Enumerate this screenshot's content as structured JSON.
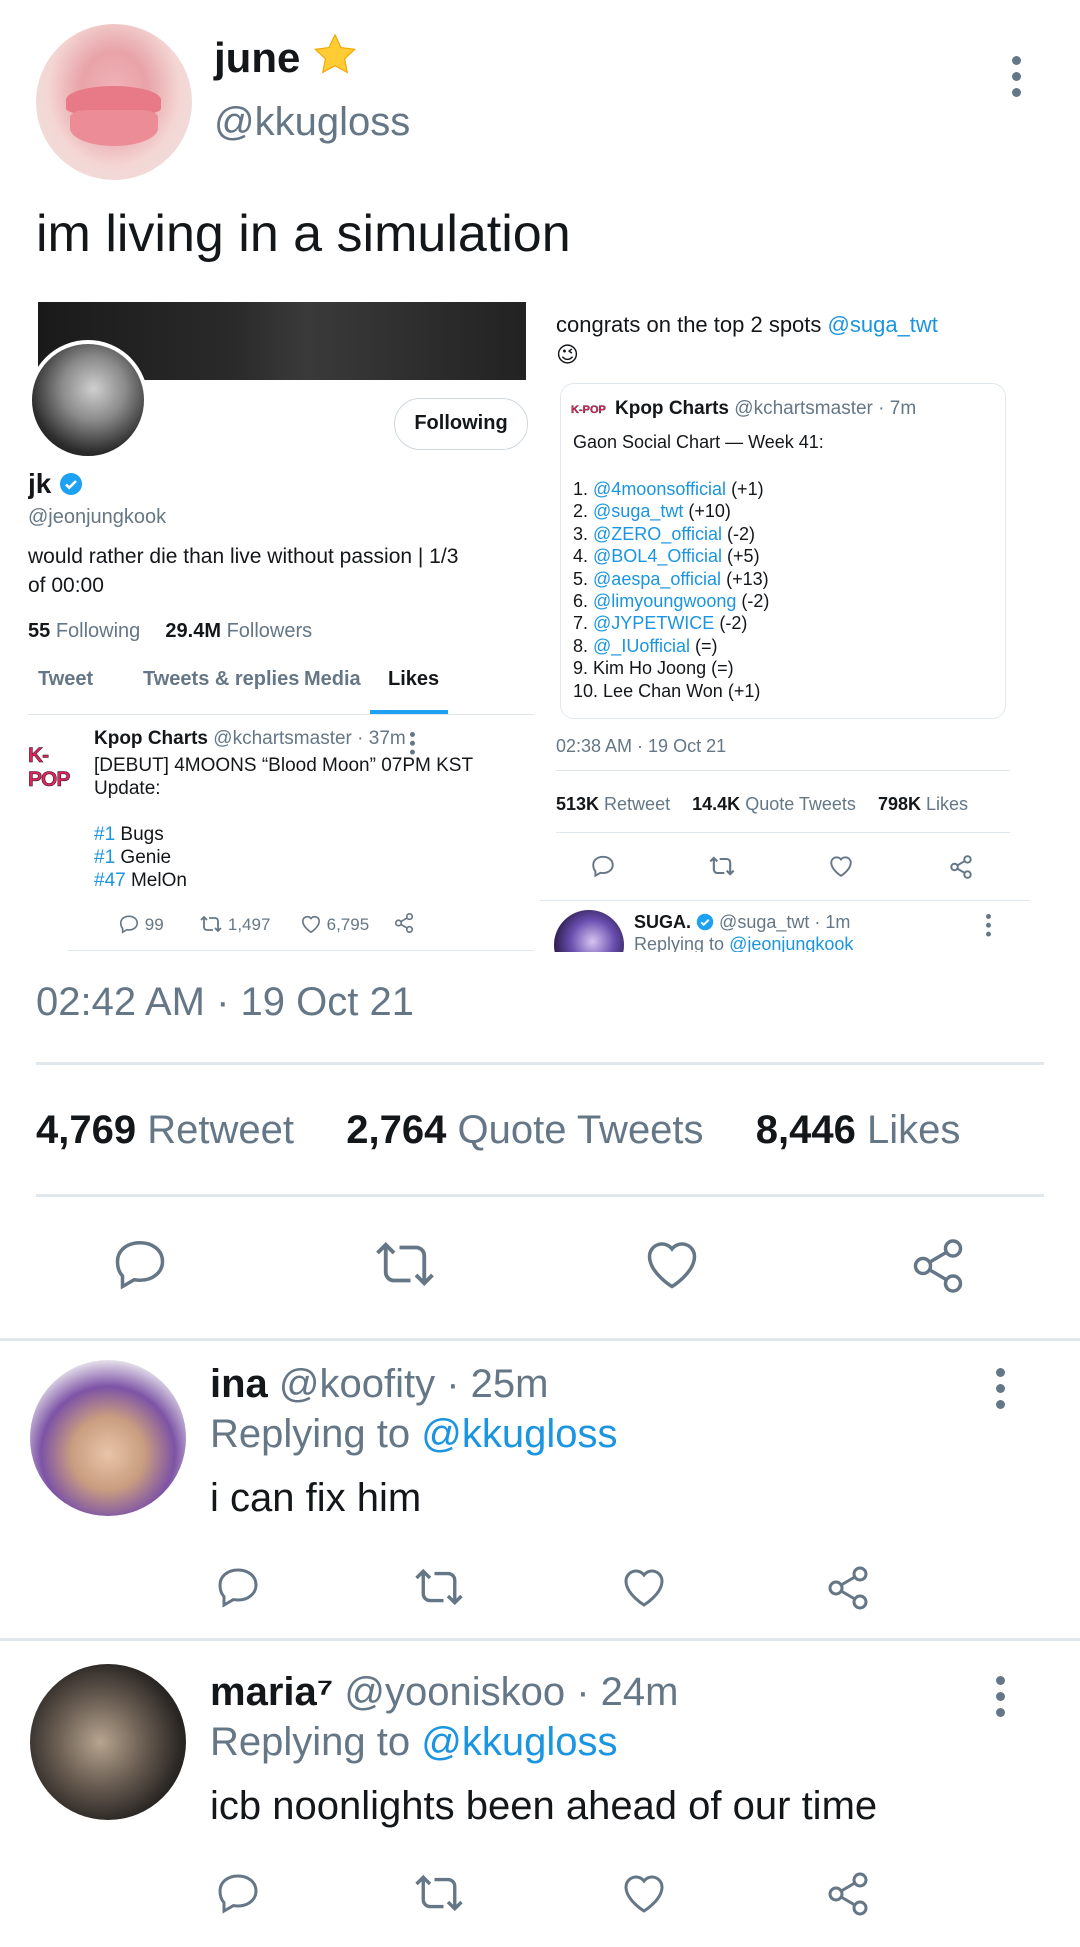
{
  "tweet": {
    "display_name": "june",
    "handle": "@kkugloss",
    "text": "im living in a simulation",
    "timestamp": "02:42 AM · 19 Oct 21",
    "stats": {
      "retweets_count": "4,769",
      "retweets_label": "Retweet",
      "quotes_count": "2,764",
      "quotes_label": "Quote Tweets",
      "likes_count": "8,446",
      "likes_label": "Likes"
    }
  },
  "embedded_left": {
    "follow_button": "Following",
    "name": "jk",
    "handle": "@jeonjungkook",
    "bio_line1": "would rather die than live without passion | 1/3",
    "bio_line2": "of 00:00",
    "following_count": "55",
    "following_label": "Following",
    "followers_count": "29.4M",
    "followers_label": "Followers",
    "tabs": [
      "Tweet",
      "Tweets & replies",
      "Media",
      "Likes"
    ],
    "active_tab": "Likes",
    "liked_tweet": {
      "logo": "K-POP",
      "name": "Kpop Charts",
      "handle_time": "@kchartsmaster · 37m",
      "line1": "[DEBUT] 4MOONS “Blood Moon” 07PM KST",
      "line2": "Update:",
      "items": [
        {
          "tag": "#1",
          "text": "Bugs"
        },
        {
          "tag": "#1",
          "text": "Genie"
        },
        {
          "tag": "#47",
          "text": "MelOn"
        }
      ],
      "replies": "99",
      "retweets": "1,497",
      "likes": "6,795"
    }
  },
  "embedded_right": {
    "text": "congrats on the top 2 spots",
    "mention": "@suga_twt",
    "emoji": "😉",
    "quoted": {
      "logo": "K-POP",
      "name": "Kpop Charts",
      "handle_time": "@kchartsmaster · 7m",
      "title": "Gaon Social Chart — Week 41:",
      "rankings": [
        {
          "n": "1.",
          "name": "@4moonsofficial",
          "change": "(+1)",
          "link": true
        },
        {
          "n": "2.",
          "name": "@suga_twt",
          "change": "(+10)",
          "link": true
        },
        {
          "n": "3.",
          "name": "@ZERO_official",
          "change": "(-2)",
          "link": true
        },
        {
          "n": "4.",
          "name": "@BOL4_Official",
          "change": "(+5)",
          "link": true
        },
        {
          "n": "5.",
          "name": "@aespa_official",
          "change": "(+13)",
          "link": true
        },
        {
          "n": "6.",
          "name": "@limyoungwoong",
          "change": "(-2)",
          "link": true
        },
        {
          "n": "7.",
          "name": "@JYPETWICE",
          "change": "(-2)",
          "link": true
        },
        {
          "n": "8.",
          "name": "@_IUofficial",
          "change": "(=)",
          "link": true
        },
        {
          "n": "9.",
          "name": "Kim Ho Joong",
          "change": "(=)",
          "link": false
        },
        {
          "n": "10.",
          "name": "Lee Chan Won",
          "change": "(+1)",
          "link": false
        }
      ]
    },
    "timestamp": "02:38 AM · 19 Oct 21",
    "retweets_count": "513K",
    "retweets_label": "Retweet",
    "quotes_count": "14.4K",
    "quotes_label": "Quote Tweets",
    "likes_count": "798K",
    "likes_label": "Likes",
    "reply_name": "SUGA.",
    "reply_handle_time": "@suga_twt · 1m",
    "reply_to_prefix": "Replying to",
    "reply_to": "@jeonjungkook"
  },
  "replies": [
    {
      "name": "ina",
      "handle_time": "@koofity · 25m",
      "replying_prefix": "Replying to",
      "replying_to": "@kkugloss",
      "text": "i can fix him"
    },
    {
      "name": "maria⁷",
      "handle_time": "@yooniskoo · 24m",
      "replying_prefix": "Replying to",
      "replying_to": "@kkugloss",
      "text": "icb noonlights been ahead of our time"
    }
  ],
  "colors": {
    "accent": "#1da1f2",
    "text": "#14171a",
    "secondary": "#657786",
    "divider": "#e1e8ed"
  },
  "icons": [
    "star-emoji-icon",
    "more-icon",
    "reply-icon",
    "retweet-icon",
    "like-icon",
    "share-icon",
    "verified-icon"
  ]
}
